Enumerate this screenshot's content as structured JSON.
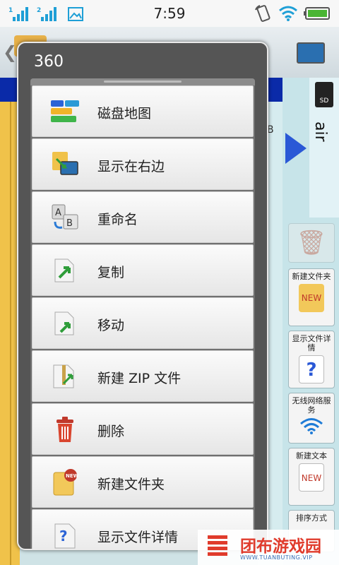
{
  "status_bar": {
    "time": "7:59",
    "sim1_label": "1",
    "sim2_label": "2"
  },
  "background": {
    "size_fragment": "B",
    "storage_label": "air",
    "sd_label": "SD",
    "side_buttons": [
      {
        "label": "新建文件夹",
        "icon": "new-folder-icon"
      },
      {
        "label": "显示文件详情",
        "icon": "file-info-icon"
      },
      {
        "label": "无线网络服务",
        "icon": "wifi-icon"
      },
      {
        "label": "新建文本",
        "icon": "new-text-icon"
      },
      {
        "label": "排序方式",
        "icon": "sort-icon"
      }
    ]
  },
  "dialog": {
    "title": "360",
    "items": [
      {
        "label": "磁盘地图",
        "icon": "disk-map-icon"
      },
      {
        "label": "显示在右边",
        "icon": "show-right-icon"
      },
      {
        "label": "重命名",
        "icon": "rename-icon"
      },
      {
        "label": "复制",
        "icon": "copy-icon"
      },
      {
        "label": "移动",
        "icon": "move-icon"
      },
      {
        "label": "新建 ZIP 文件",
        "icon": "zip-icon"
      },
      {
        "label": "删除",
        "icon": "trash-icon"
      },
      {
        "label": "新建文件夹",
        "icon": "new-folder-icon"
      },
      {
        "label": "显示文件详情",
        "icon": "file-info-icon"
      }
    ]
  },
  "watermark": {
    "cn": "团布游戏园",
    "en": "WWW.TUANBUTING.VIP"
  },
  "colors": {
    "dialog_bg": "#555555",
    "accent_blue": "#0a2aa8",
    "watermark_red": "#e03b2c"
  }
}
